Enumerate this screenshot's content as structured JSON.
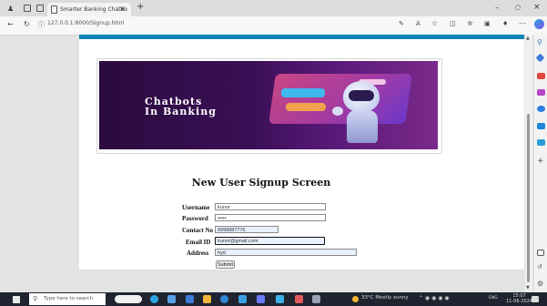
{
  "browser": {
    "tab_title": "Smarter Banking Chatbo",
    "url": "127.0.0.1:8000/Signup.html"
  },
  "page": {
    "banner_line1": "Chatbots",
    "banner_line2": "In Banking",
    "heading": "New User Signup Screen",
    "form": {
      "username_label": "Username",
      "username_value": "kunor",
      "password_label": "Password",
      "password_value": "•••••",
      "contact_label": "Contact No",
      "contact_value": "9998887776",
      "email_label": "Email ID",
      "email_value": "kunor@gmail.com",
      "address_label": "Address",
      "address_value": "hyd",
      "submit_label": "Submit"
    }
  },
  "taskbar": {
    "search_placeholder": "Type here to search",
    "weather": "33°C  Mostly sunny",
    "lang": "ENG",
    "time": "15:07",
    "date": "11-06-2024"
  },
  "colors": {
    "accent": "#0e86b5",
    "banner_dark": "#2a0c3d",
    "taskbar": "#1f2430"
  }
}
